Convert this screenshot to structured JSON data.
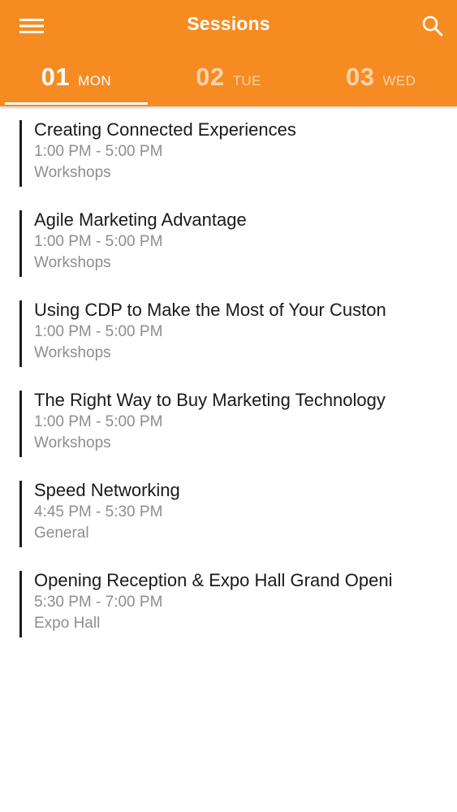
{
  "header": {
    "title": "Sessions",
    "background_color": "#F68B21",
    "menu_icon": "hamburger-menu-icon",
    "search_icon": "search-icon"
  },
  "tabs": [
    {
      "number": "01",
      "day": "MON",
      "selected": true
    },
    {
      "number": "02",
      "day": "TUE",
      "selected": false
    },
    {
      "number": "03",
      "day": "WED",
      "selected": false
    }
  ],
  "sessions": [
    {
      "title": "Creating Connected Experiences",
      "time": "1:00 PM - 5:00 PM",
      "track": "Workshops"
    },
    {
      "title": "Agile Marketing Advantage",
      "time": "1:00 PM - 5:00 PM",
      "track": "Workshops"
    },
    {
      "title": "Using CDP to Make the Most of Your Custon",
      "time": "1:00 PM - 5:00 PM",
      "track": "Workshops"
    },
    {
      "title": "The Right Way to Buy Marketing Technology",
      "time": "1:00 PM - 5:00 PM",
      "track": "Workshops"
    },
    {
      "title": "Speed Networking",
      "time": "4:45 PM - 5:30 PM",
      "track": "General"
    },
    {
      "title": "Opening Reception & Expo Hall Grand Openi",
      "time": "5:30 PM - 7:00 PM",
      "track": "Expo Hall"
    }
  ]
}
